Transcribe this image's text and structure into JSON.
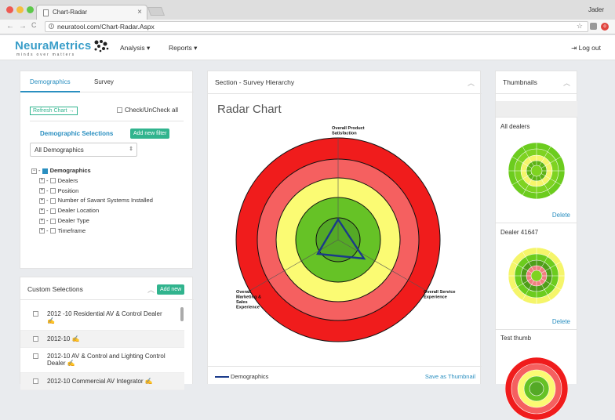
{
  "browser": {
    "tab_title": "Chart-Radar",
    "tab_close": "×",
    "url": "neuratool.com/Chart-Radar.Aspx",
    "user": "Jader",
    "back": "←",
    "forward": "→",
    "reload": "C",
    "bookmark": "☆",
    "extension_label": "o",
    "lock_icon": "i"
  },
  "appnav": {
    "logo_text": "NeuraMetrics",
    "logo_tagline": "minds over matters",
    "menu": [
      "Analysis",
      "Reports"
    ],
    "logout": "Log out",
    "logout_icon": "⇥"
  },
  "left": {
    "tabs": [
      "Demographics",
      "Survey"
    ],
    "refresh_label": "Refresh Chart →",
    "check_all_label": "Check/UnCheck all",
    "selections_title": "Demographic Selections",
    "add_filter_label": "Add new filter",
    "select_value": "All Demographics",
    "select_caret": "⇕",
    "tree_toggle_minus": "−",
    "tree_toggle_plus": "+",
    "tree_root": "Demographics",
    "tree_items": [
      "Dealers",
      "Position",
      "Number of Savant Systems Installed",
      "Dealer Location",
      "Dealer Type",
      "Timeframe"
    ]
  },
  "custom": {
    "title": "Custom Selections",
    "add_label": "Add new",
    "edit_icon": "✍",
    "items": [
      {
        "line1": "2012 -10 Residential AV & Control Dealer",
        "line2": ""
      },
      {
        "line1": "2012-10",
        "line2": ""
      },
      {
        "line1": "2012-10 AV & Control and Lighting Control",
        "line2": "Dealer"
      },
      {
        "line1": "2012-10 Commercial AV Integrator",
        "line2": ""
      }
    ]
  },
  "center": {
    "section_title": "Section - Survey Hierarchy",
    "chart_title": "Radar Chart",
    "legend_label": "Demographics",
    "save_label": "Save as Thumbnail",
    "collapse_icon": "︿"
  },
  "chart_data": {
    "type": "radar",
    "axes": [
      "Overall Product Satisfaction",
      "Overall Service Experience",
      "Overall Marketing & Sales Experience"
    ],
    "bands": [
      {
        "name": "band-1",
        "color": "#f01c1c"
      },
      {
        "name": "band-2",
        "color": "#f56060"
      },
      {
        "name": "band-3",
        "color": "#fbfb73"
      },
      {
        "name": "band-4",
        "color": "#66c226"
      },
      {
        "name": "band-5",
        "color": "#54a926"
      }
    ],
    "series": [
      {
        "name": "Demographics",
        "color": "#1a3a8a"
      }
    ]
  },
  "thumbnails": {
    "title": "Thumbnails",
    "items": [
      {
        "title": "All dealers",
        "delete": "Delete"
      },
      {
        "title": "Dealer 41647",
        "delete": "Delete"
      },
      {
        "title": "Test thumb",
        "delete": ""
      }
    ]
  }
}
